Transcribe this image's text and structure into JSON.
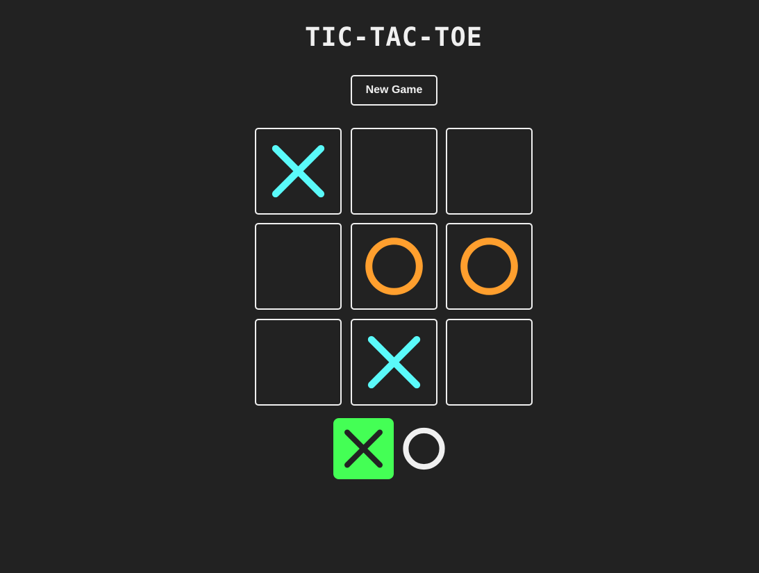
{
  "title": "TIC-TAC-TOE",
  "new_game_label": "New Game",
  "board": [
    "X",
    "",
    "",
    "",
    "O",
    "O",
    "",
    "X",
    ""
  ],
  "turn_indicator": {
    "players": [
      "X",
      "O"
    ],
    "active": "X"
  },
  "colors": {
    "background": "#222222",
    "foreground": "#f0f0f0",
    "x_mark": "#5afafa",
    "o_mark": "#ff9f2e",
    "active_turn_bg": "#44ff55",
    "active_turn_mark": "#222222"
  }
}
